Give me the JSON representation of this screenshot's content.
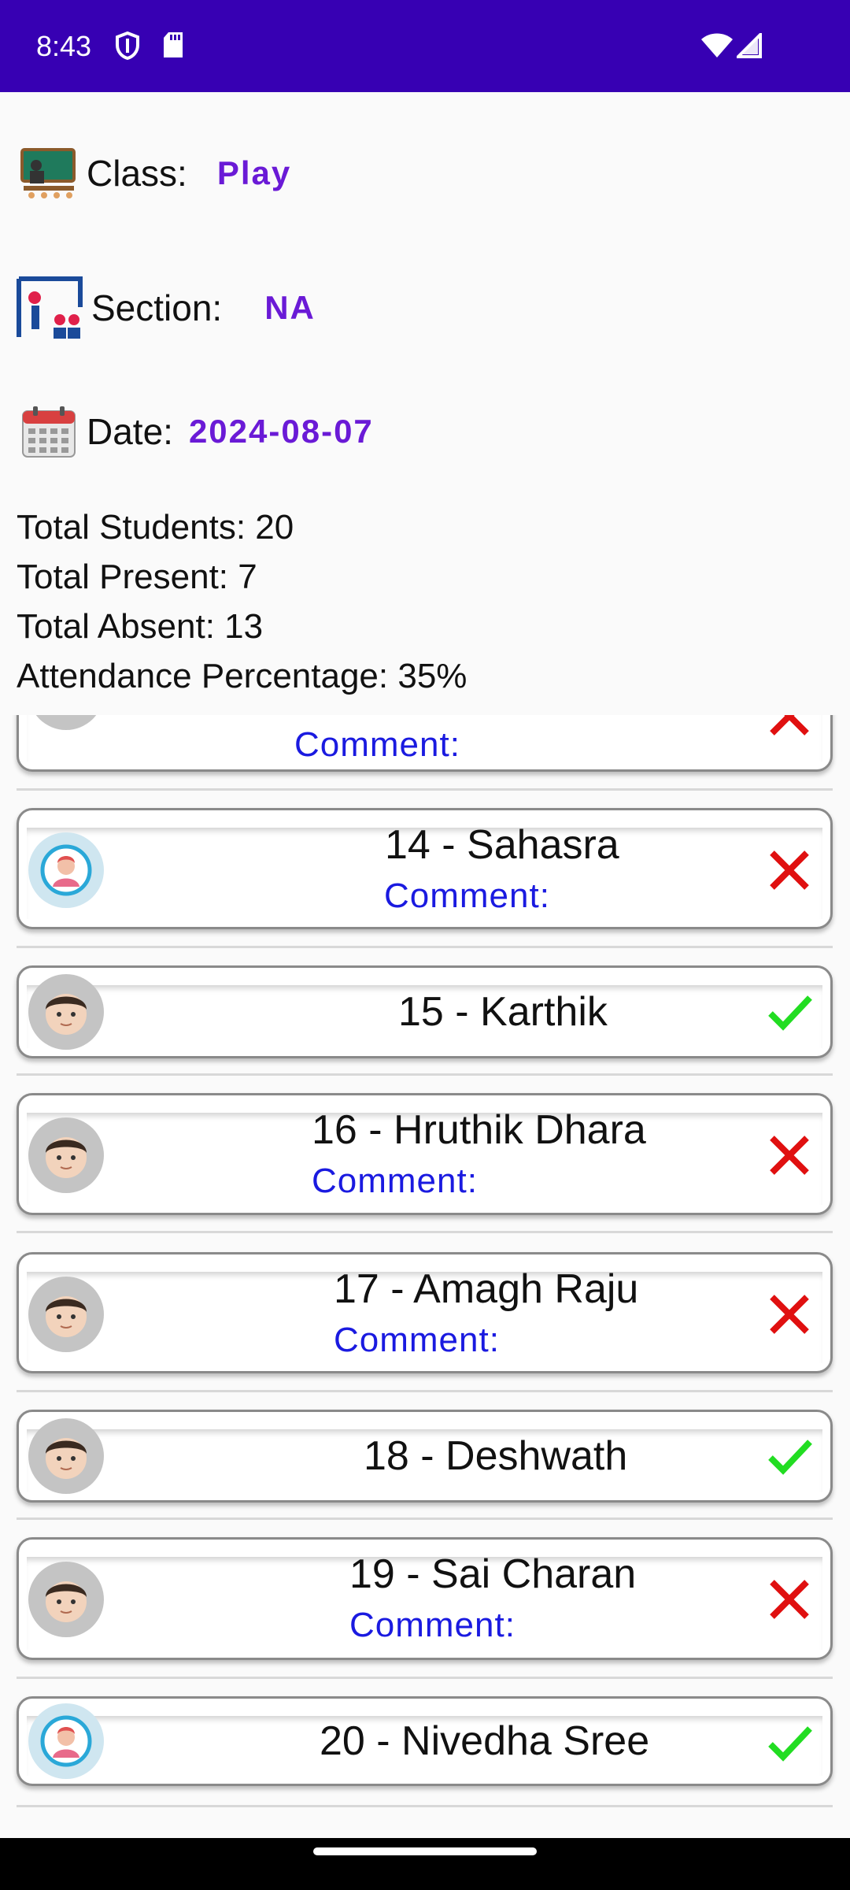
{
  "status_bar": {
    "time": "8:43",
    "icons": [
      "shield-icon",
      "sd-card-icon",
      "wifi-icon",
      "signal-icon"
    ],
    "background": "#3700b3"
  },
  "header": {
    "class_label": "Class:",
    "class_value": "Play",
    "section_label": "Section:",
    "section_value": "NA",
    "date_label": "Date:",
    "date_value": "2024-08-07",
    "accent": "#6a1ad6"
  },
  "stats": {
    "total_students": "Total Students: 20",
    "total_present": "Total Present: 7",
    "total_absent": "Total Absent: 13",
    "attendance_percentage": "Attendance Percentage: 35%"
  },
  "students": [
    {
      "name": "",
      "comment": "Comment:",
      "status": "absent",
      "avatar": "boy-avatar-icon"
    },
    {
      "name": "14 - Sahasra",
      "comment": "Comment:",
      "status": "absent",
      "avatar": "girl-avatar-icon"
    },
    {
      "name": "15 - Karthik",
      "comment": "",
      "status": "present",
      "avatar": "boy-avatar-icon"
    },
    {
      "name": "16 - Hruthik Dhara",
      "comment": "Comment:",
      "status": "absent",
      "avatar": "boy-avatar-icon"
    },
    {
      "name": "17 - Amagh Raju",
      "comment": "Comment:",
      "status": "absent",
      "avatar": "boy-avatar-icon"
    },
    {
      "name": "18 - Deshwath",
      "comment": "",
      "status": "present",
      "avatar": "boy-avatar-icon"
    },
    {
      "name": "19 - Sai Charan",
      "comment": "Comment:",
      "status": "absent",
      "avatar": "boy-avatar-icon"
    },
    {
      "name": "20 - Nivedha Sree",
      "comment": "",
      "status": "present",
      "avatar": "girl-avatar-icon"
    }
  ],
  "colors": {
    "present": "#22dd22",
    "absent": "#e01010",
    "comment": "#1a1ae0"
  }
}
